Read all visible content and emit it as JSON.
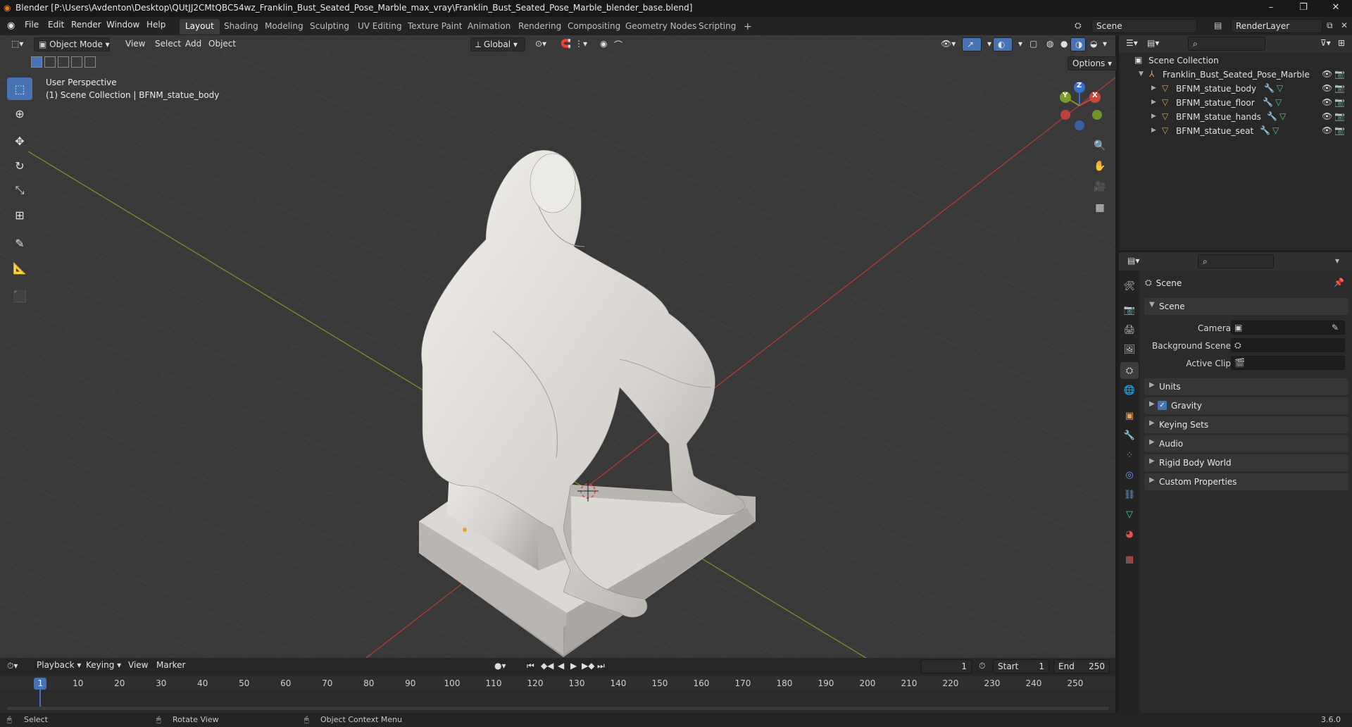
{
  "window": {
    "title": "Blender [P:\\Users\\Avdenton\\Desktop\\QUtJJ2CMtQBC54wz_Franklin_Bust_Seated_Pose_Marble_max_vray\\Franklin_Bust_Seated_Pose_Marble_blender_base.blend]",
    "minimize": "–",
    "maximize": "❐",
    "close": "✕"
  },
  "menu": [
    "File",
    "Edit",
    "Render",
    "Window",
    "Help"
  ],
  "workspaces": [
    {
      "label": "Layout",
      "active": true
    },
    {
      "label": "Shading"
    },
    {
      "label": "Modeling"
    },
    {
      "label": "Sculpting"
    },
    {
      "label": "UV Editing"
    },
    {
      "label": "Texture Paint"
    },
    {
      "label": "Animation"
    },
    {
      "label": "Rendering"
    },
    {
      "label": "Compositing"
    },
    {
      "label": "Geometry Nodes"
    },
    {
      "label": "Scripting"
    }
  ],
  "add_workspace": "+",
  "scene_selector": {
    "label": "Scene"
  },
  "view_layer_selector": {
    "label": "RenderLayer"
  },
  "viewport_header": {
    "mode": "Object Mode",
    "menus": [
      "View",
      "Select",
      "Add",
      "Object"
    ],
    "transform_orientation": "Global",
    "options": "Options"
  },
  "viewport_overlay": {
    "perspective": "User Perspective",
    "collection_info": "(1) Scene Collection | BFNM_statue_body"
  },
  "gizmo": {
    "x": "X",
    "y": "Y",
    "z": "Z"
  },
  "outliner": {
    "root": "Scene Collection",
    "collection": "Franklin_Bust_Seated_Pose_Marble",
    "objects": [
      "BFNM_statue_body",
      "BFNM_statue_floor",
      "BFNM_statue_hands",
      "BFNM_statue_seat"
    ]
  },
  "properties": {
    "context_title": "Scene",
    "panel_scene": "Scene",
    "rows": [
      {
        "key": "Camera",
        "value": ""
      },
      {
        "key": "Background Scene",
        "value": ""
      },
      {
        "key": "Active Clip",
        "value": ""
      }
    ],
    "panels": [
      "Units",
      "Gravity",
      "Keying Sets",
      "Audio",
      "Rigid Body World",
      "Custom Properties"
    ],
    "gravity_checked": true
  },
  "timeline": {
    "menus": [
      "Playback",
      "Keying",
      "View",
      "Marker"
    ],
    "current_frame": "1",
    "start_label": "Start",
    "start": "1",
    "end_label": "End",
    "end": "250",
    "ruler": [
      "1",
      "10",
      "20",
      "30",
      "40",
      "50",
      "60",
      "70",
      "80",
      "90",
      "100",
      "110",
      "120",
      "130",
      "140",
      "150",
      "160",
      "170",
      "180",
      "190",
      "200",
      "210",
      "220",
      "230",
      "240",
      "250"
    ]
  },
  "statusbar": {
    "select": "Select",
    "rotate": "Rotate View",
    "context_menu": "Object Context Menu",
    "version": "3.6.0"
  },
  "colors": {
    "accent": "#4772b3",
    "axis_x": "#c8463e",
    "axis_y": "#7a9c2a",
    "viewport_bg": "#393939"
  }
}
